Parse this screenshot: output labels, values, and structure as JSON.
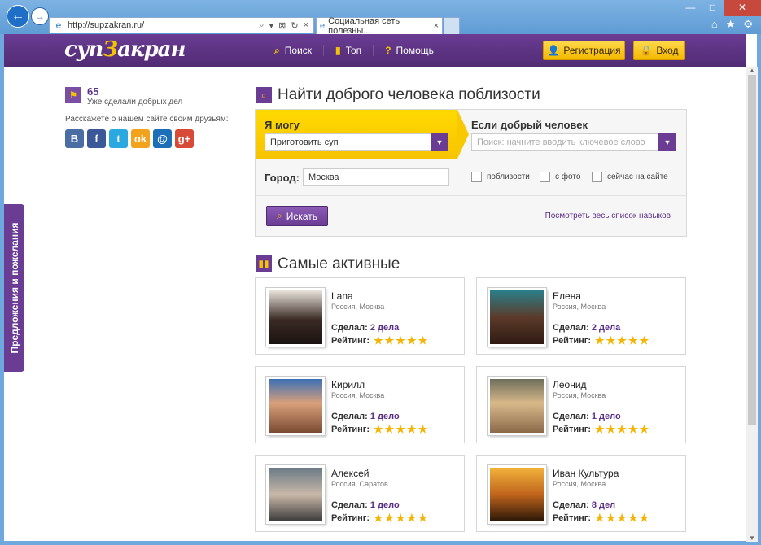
{
  "browser": {
    "url": "http://supzakran.ru/",
    "tab_title": "Социальная сеть полезны...",
    "tab_close": "×",
    "back_glyph": "←",
    "forward_glyph": "→",
    "addr_controls": [
      "⌕",
      "▾",
      "⊠",
      "↻",
      "×"
    ],
    "win_buttons": [
      "—",
      "□",
      "✕"
    ],
    "tools": [
      "⌂",
      "★",
      "⚙"
    ]
  },
  "header": {
    "logo_pre": "суп",
    "logo_z": "З",
    "logo_post": "акран",
    "nav": [
      {
        "icon": "⌕",
        "label": "Поиск"
      },
      {
        "icon": "▮",
        "label": "Топ"
      },
      {
        "icon": "?",
        "label": "Помощь"
      }
    ],
    "register_label": "Регистрация",
    "login_label": "Вход"
  },
  "sidebar": {
    "count": "65",
    "count_label": "Уже сделали добрых дел",
    "tell_text": "Расскажете о нашем сайте своим друзьям:",
    "socials": [
      {
        "label": "B",
        "color": "#4a6ea4"
      },
      {
        "label": "f",
        "color": "#3b5998"
      },
      {
        "label": "t",
        "color": "#2aa9e0"
      },
      {
        "label": "ok",
        "color": "#f2a21b"
      },
      {
        "label": "@",
        "color": "#1d6fb8"
      },
      {
        "label": "g+",
        "color": "#d84a38"
      }
    ],
    "feedback_tab": "Предложения и пожелания"
  },
  "search": {
    "title": "Найти доброго человека поблизости",
    "can_label": "Я могу",
    "can_value": "Приготовить суп",
    "if_label": "Если добрый человек",
    "if_placeholder": "Поиск: начните вводить ключевое слово",
    "city_label": "Город:",
    "city_value": "Москва",
    "checkboxes": [
      "поблизости",
      "с фото",
      "сейчас на сайте"
    ],
    "search_button": "Искать",
    "all_skills_link": "Посмотреть весь список навыков"
  },
  "active": {
    "title": "Самые активные",
    "done_label": "Сделал:",
    "rating_label": "Рейтинг:",
    "star_glyph": "★",
    "users": [
      {
        "name": "Lana",
        "location": "Россия, Москва",
        "deeds": "2 дела",
        "stars": 5
      },
      {
        "name": "Елена",
        "location": "Россия, Москва",
        "deeds": "2 дела",
        "stars": 5
      },
      {
        "name": "Кирилл",
        "location": "Россия, Москва",
        "deeds": "1 дело",
        "stars": 5
      },
      {
        "name": "Леонид",
        "location": "Россия, Москва",
        "deeds": "1 дело",
        "stars": 5
      },
      {
        "name": "Алексей",
        "location": "Россия, Саратов",
        "deeds": "1 дело",
        "stars": 5
      },
      {
        "name": "Иван Культура",
        "location": "Россия, Москва",
        "deeds": "8 дел",
        "stars": 5
      }
    ]
  },
  "colors": {
    "brand_purple": "#6a3c93",
    "brand_yellow": "#f5c400"
  }
}
